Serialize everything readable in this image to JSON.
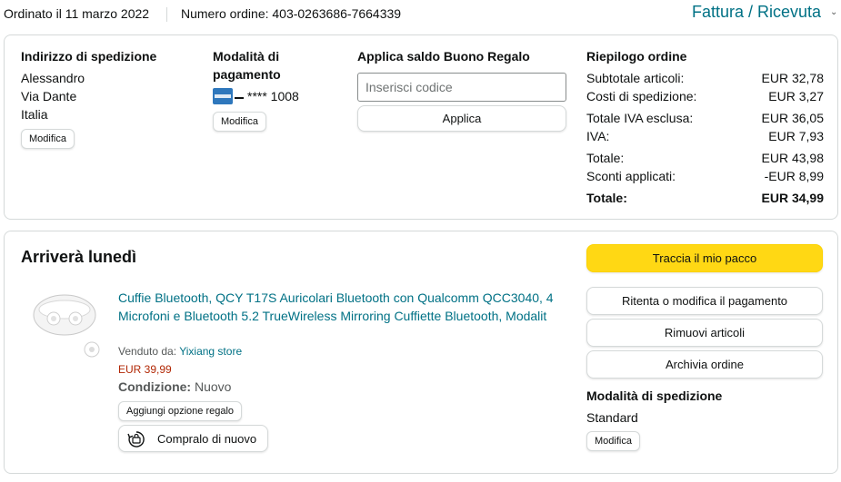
{
  "header": {
    "order_date": "Ordinato il 11 marzo 2022",
    "order_number": "Numero ordine: 403-0263686-7664339",
    "invoice_link": "Fattura / Ricevuta"
  },
  "shipping_address": {
    "heading": "Indirizzo di spedizione",
    "lines": [
      "Alessandro",
      "Via Dante",
      "Italia"
    ],
    "edit_label": "Modifica"
  },
  "payment": {
    "heading_line1": "Modalità di",
    "heading_line2": "pagamento",
    "card_icon": "amex-card-icon",
    "card_digits": "**** 1008",
    "edit_label": "Modifica"
  },
  "gift_card": {
    "heading": "Applica saldo Buono Regalo",
    "input_placeholder": "Inserisci codice",
    "apply_label": "Applica"
  },
  "summary": {
    "heading": "Riepilogo ordine",
    "rows": [
      {
        "label": "Subtotale articoli:",
        "value": "EUR 32,78"
      },
      {
        "label": "Costi di spedizione:",
        "value": "EUR 3,27"
      },
      {
        "label": "Totale IVA esclusa:",
        "value": "EUR 36,05"
      },
      {
        "label": "IVA:",
        "value": "EUR 7,93"
      },
      {
        "label": "Totale:",
        "value": "EUR 43,98"
      },
      {
        "label": "Sconti applicati:",
        "value": "-EUR 8,99"
      },
      {
        "label": "Totale:",
        "value": "EUR 34,99"
      }
    ]
  },
  "shipment": {
    "arrival": "Arriverà lunedì",
    "product": {
      "title": "Cuffie Bluetooth, QCY T17S Auricolari Bluetooth con Qualcomm QCC3040, 4 Microfoni e Bluetooth 5.2 TrueWireless Mirroring Cuffiette Bluetooth, Modalit",
      "sold_by_label": "Venduto da:",
      "seller": "Yixiang store",
      "price": "EUR 39,99",
      "condition_label": "Condizione:",
      "condition_value": "Nuovo",
      "gift_option_label": "Aggiungi opzione regalo",
      "buy_again_label": "Compralo di nuovo"
    },
    "actions": {
      "track": "Traccia il mio pacco",
      "retry_payment": "Ritenta o modifica il pagamento",
      "remove_items": "Rimuovi articoli",
      "archive": "Archivia ordine"
    },
    "shipping_mode": {
      "heading": "Modalità di spedizione",
      "value": "Standard",
      "edit_label": "Modifica"
    }
  },
  "colors": {
    "link": "#007185",
    "price": "#b12704",
    "track_button": "#ffd814",
    "border": "#d5d9d9"
  }
}
